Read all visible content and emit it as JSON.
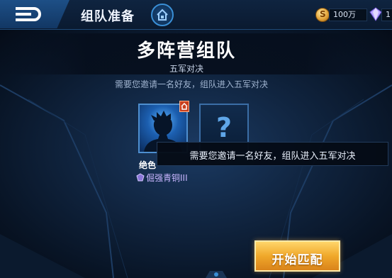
{
  "header": {
    "title": "组队准备",
    "gold_amount": "100万",
    "diamond_amount": "1"
  },
  "mode": {
    "title": "多阵营组队",
    "subtitle": "五军对决",
    "invite_hint": "需要您邀请一名好友，组队进入五军对决"
  },
  "team": {
    "slot_1": {
      "player_name": "绝色",
      "rank": "倔强青铜III"
    },
    "slot_2": {
      "placeholder": "?"
    }
  },
  "tooltip": {
    "text": "需要您邀请一名好友，组队进入五军对决"
  },
  "actions": {
    "start_label": "开始匹配"
  },
  "icons": {
    "back": "back-arrow-icon",
    "home": "home-icon",
    "gold": "gold-coin-icon",
    "diamond": "diamond-icon",
    "host": "host-crown-icon",
    "rank": "rank-emblem-icon"
  },
  "colors": {
    "accent": "#3a8fd6",
    "start_button": "#f0a82a",
    "rank_text": "#c9b6ff"
  }
}
